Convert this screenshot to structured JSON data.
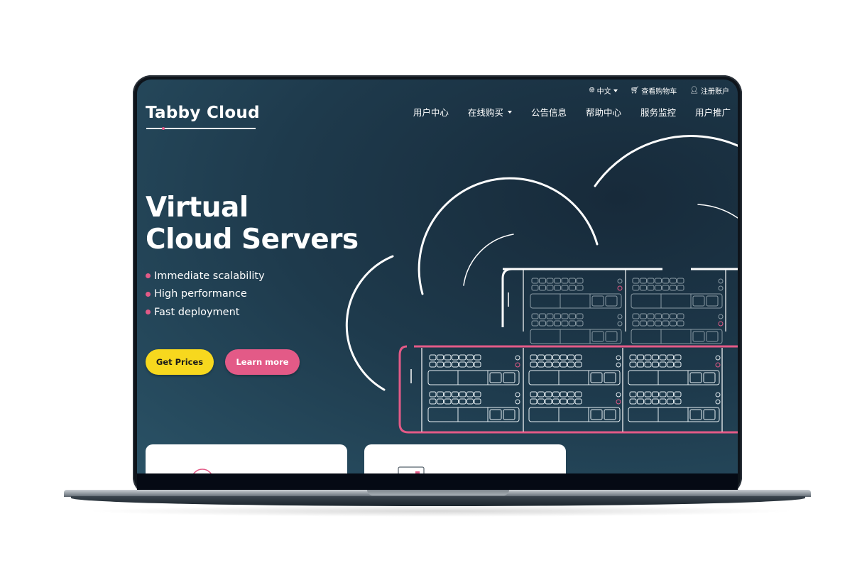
{
  "topbar": {
    "language": {
      "label": "中文",
      "icon": "globe-icon"
    },
    "cart": {
      "label": "查看购物车",
      "icon": "cart-icon"
    },
    "register": {
      "label": "注册账户",
      "icon": "user-add-icon"
    }
  },
  "brand": {
    "name": "Tabby Cloud"
  },
  "nav": {
    "items": [
      {
        "label": "用户中心",
        "dropdown": false
      },
      {
        "label": "在线购买",
        "dropdown": true
      },
      {
        "label": "公告信息",
        "dropdown": false
      },
      {
        "label": "帮助中心",
        "dropdown": false
      },
      {
        "label": "服务监控",
        "dropdown": false
      },
      {
        "label": "用户推广",
        "dropdown": false
      }
    ]
  },
  "hero": {
    "title_line1": "Virtual",
    "title_line2": "Cloud Servers",
    "features": [
      "Immediate scalability",
      "High performance",
      "Fast deployment"
    ],
    "primary_button": "Get Prices",
    "secondary_button": "Learn more"
  },
  "colors": {
    "accent_pink": "#e35a87",
    "accent_yellow": "#f7d81e",
    "background_dark": "#1e3a4c"
  }
}
